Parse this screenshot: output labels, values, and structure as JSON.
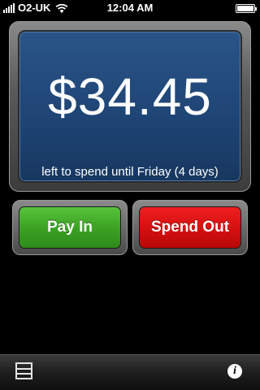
{
  "status_bar": {
    "carrier": "O2-UK",
    "time": "12:04 AM",
    "battery_level": 1.0
  },
  "balance": {
    "amount": "$34.45",
    "subtext": "left to spend until Friday (4 days)"
  },
  "buttons": {
    "pay_in": "Pay In",
    "spend_out": "Spend Out"
  },
  "toolbar": {
    "left_icon": "list-icon",
    "right_icon": "info-icon",
    "info_glyph": "i"
  },
  "colors": {
    "panel_blue": "#1e4474",
    "pay_in_green": "#3aa022",
    "spend_out_red": "#d40f0f"
  }
}
